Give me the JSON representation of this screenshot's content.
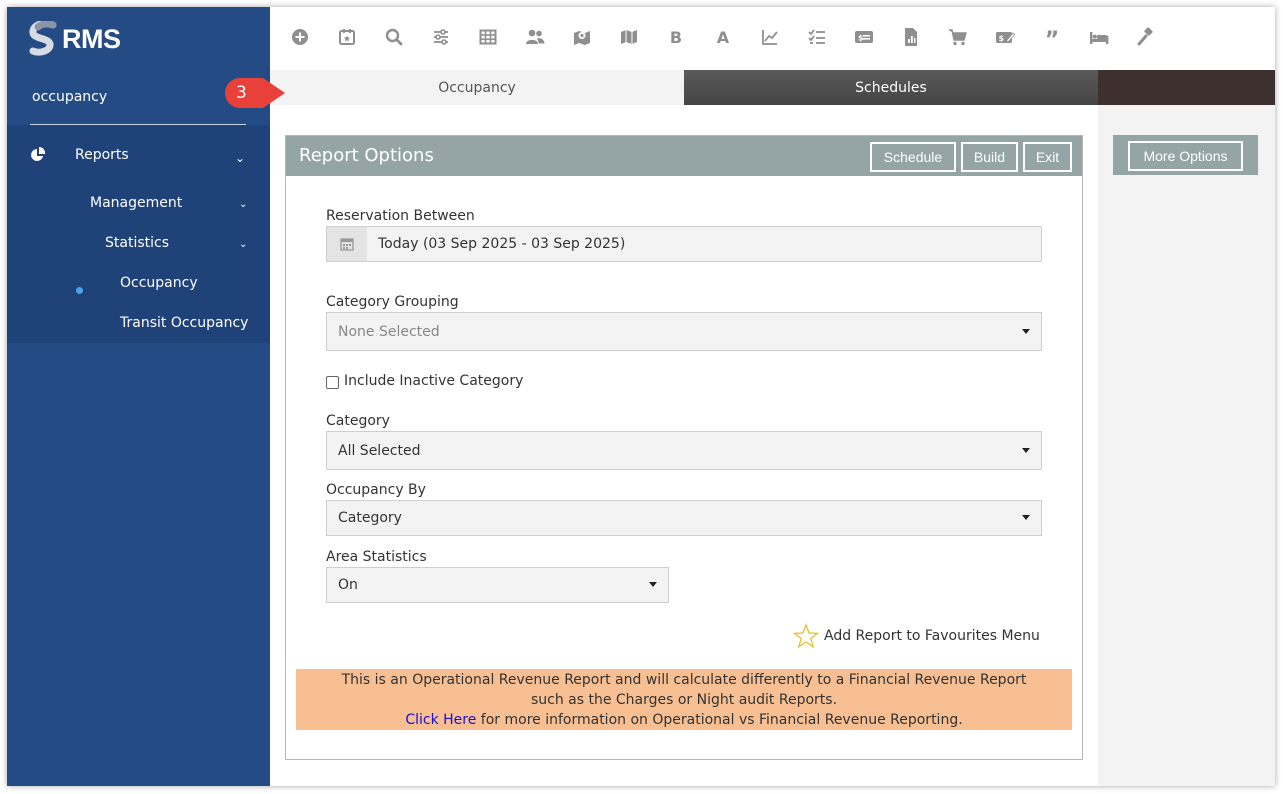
{
  "app": {
    "logo_text": "RMS",
    "brand_color": "#244b84"
  },
  "sidebar": {
    "search_text": "occupancy",
    "reports_label": "Reports",
    "management_label": "Management",
    "statistics_label": "Statistics",
    "occupancy_label": "Occupancy",
    "transit_label": "Transit Occupancy"
  },
  "toolbar": {
    "icons": [
      "add-circle-icon",
      "calendar-star-icon",
      "search-icon",
      "sliders-icon",
      "grid-icon",
      "users-icon",
      "map-pin-icon",
      "map-icon",
      "bold-b-icon",
      "letter-a-icon",
      "line-chart-icon",
      "checklist-icon",
      "money-card-icon",
      "report-file-icon",
      "cart-icon",
      "cash-edit-icon",
      "quote-icon",
      "bed-icon",
      "gavel-icon"
    ]
  },
  "callout": {
    "number": "3"
  },
  "tabs": {
    "occupancy": "Occupancy",
    "schedules": "Schedules"
  },
  "panel": {
    "title": "Report Options",
    "schedule_btn": "Schedule",
    "build_btn": "Build",
    "exit_btn": "Exit"
  },
  "form": {
    "reservation_label": "Reservation Between",
    "reservation_value": "Today (03 Sep 2025 - 03 Sep 2025)",
    "category_grouping_label": "Category Grouping",
    "category_grouping_value": "None Selected",
    "include_inactive_label": "Include Inactive Category",
    "category_label": "Category",
    "category_value": "All Selected",
    "occupancy_by_label": "Occupancy By",
    "occupancy_by_value": "Category",
    "area_stats_label": "Area Statistics",
    "area_stats_value": "On"
  },
  "favourites_label": "Add Report to Favourites Menu",
  "notice": {
    "line1": "This is an Operational Revenue Report and will calculate differently to a Financial Revenue Report",
    "line2": "such as the Charges or Night audit Reports.",
    "link_text": "Click Here",
    "line3_rest": " for more information on Operational vs Financial Revenue Reporting."
  },
  "more_options_btn": "More Options"
}
